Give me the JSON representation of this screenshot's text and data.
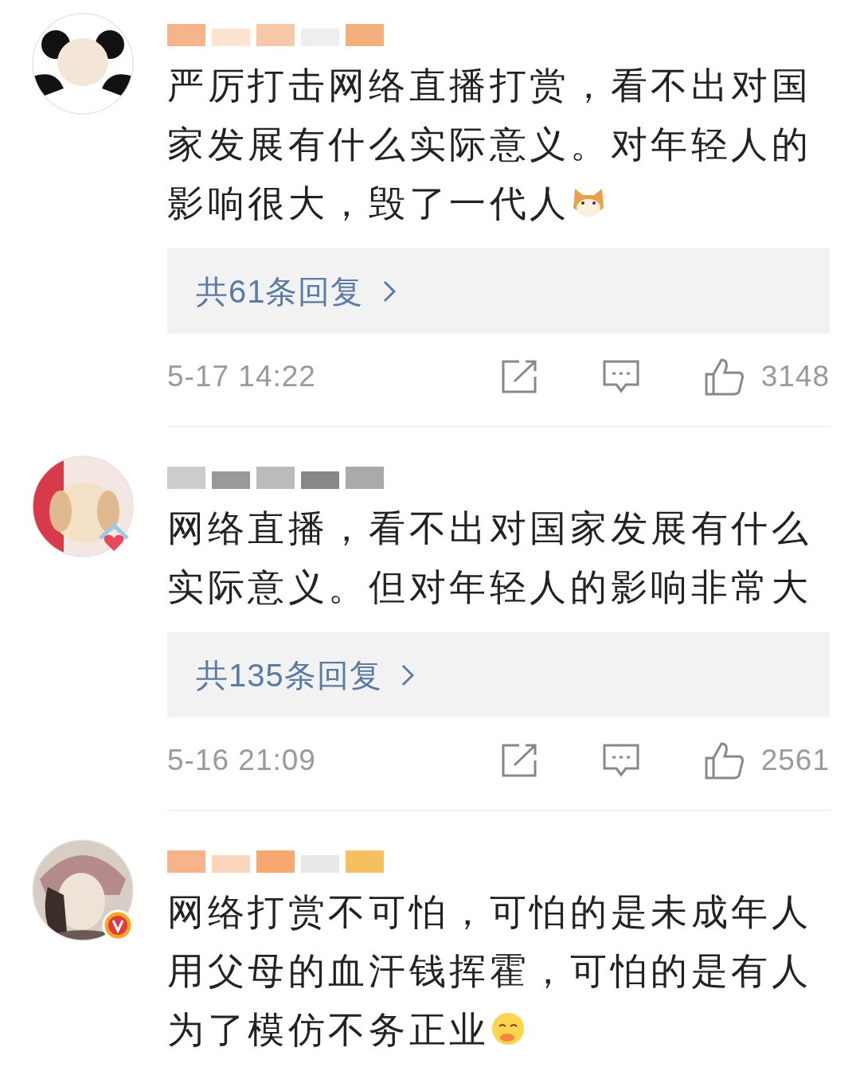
{
  "comments": [
    {
      "text": "严厉打击网络直播打赏，看不出对国家发展有什么实际意义。对年轻人的影响很大，毁了一代人",
      "replies": "共61条回复",
      "time": "5-17 14:22",
      "likes": "3148"
    },
    {
      "text": "网络直播，看不出对国家发展有什么实际意义。但对年轻人的影响非常大",
      "replies": "共135条回复",
      "time": "5-16 21:09",
      "likes": "2561"
    },
    {
      "text": "网络打赏不可怕，可怕的是未成年人用父母的血汗钱挥霍，可怕的是有人为了模仿不务正业"
    }
  ]
}
